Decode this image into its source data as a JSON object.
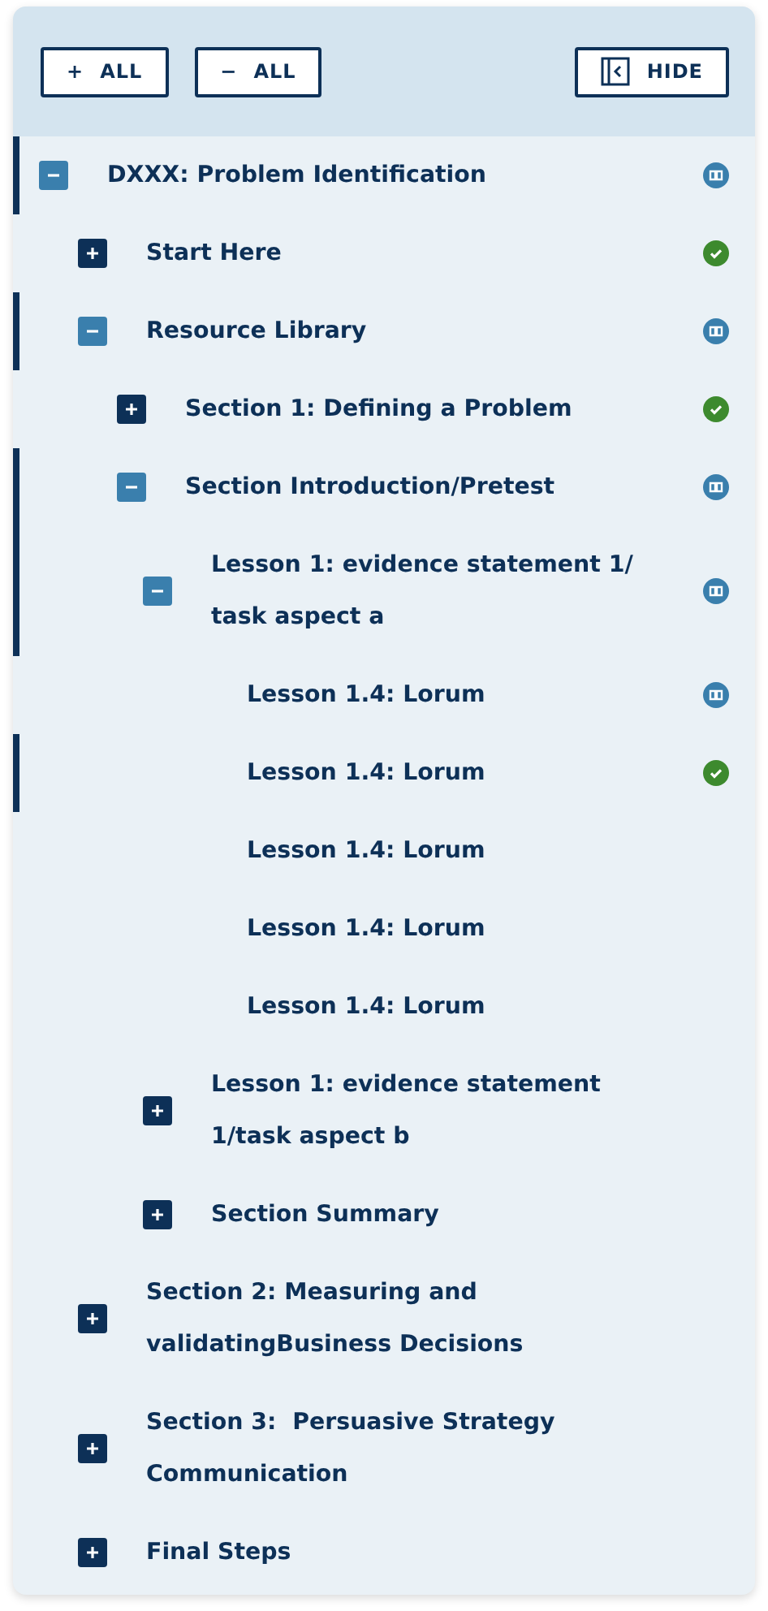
{
  "toolbar": {
    "expand_all": {
      "symbol": "+",
      "label": "ALL"
    },
    "collapse_all": {
      "symbol": "−",
      "label": "ALL"
    },
    "hide": {
      "label": "HIDE"
    }
  },
  "tree": [
    {
      "title": "DXXX: Problem Identification",
      "expanded": true,
      "highlighted": true,
      "kind": "book",
      "children": [
        {
          "title": "Start Here",
          "expanded": false,
          "highlighted": false,
          "kind": "done"
        },
        {
          "title": "Resource Library",
          "expanded": true,
          "highlighted": true,
          "kind": "book",
          "children": [
            {
              "title": "Section 1: Defining a Problem",
              "expanded": false,
              "highlighted": false,
              "kind": "done"
            },
            {
              "title": "Section Introduction/Pretest",
              "expanded": true,
              "highlighted": true,
              "kind": "book",
              "children": [
                {
                  "title": "Lesson 1: evidence statement 1/ task aspect a",
                  "expanded": true,
                  "highlighted": true,
                  "kind": "book",
                  "children": [
                    {
                      "title": "Lesson 1.4: Lorum",
                      "highlighted": false,
                      "kind": "book"
                    },
                    {
                      "title": "Lesson 1.4: Lorum",
                      "highlighted": true,
                      "kind": "done"
                    },
                    {
                      "title": "Lesson 1.4: Lorum",
                      "highlighted": false
                    },
                    {
                      "title": "Lesson 1.4: Lorum",
                      "highlighted": false
                    },
                    {
                      "title": "Lesson 1.4: Lorum",
                      "highlighted": false
                    }
                  ]
                },
                {
                  "title": "Lesson 1: evidence statement 1/task aspect b",
                  "expanded": false,
                  "highlighted": false
                },
                {
                  "title": "Section Summary",
                  "expanded": false,
                  "highlighted": false
                }
              ]
            }
          ]
        },
        {
          "title": "Section 2: Measuring and validatingBusiness Decisions",
          "expanded": false,
          "highlighted": false
        },
        {
          "title": "Section 3:  Persuasive Strategy Communication",
          "expanded": false,
          "highlighted": false
        },
        {
          "title": "Final Steps",
          "expanded": false,
          "highlighted": false
        }
      ]
    }
  ]
}
